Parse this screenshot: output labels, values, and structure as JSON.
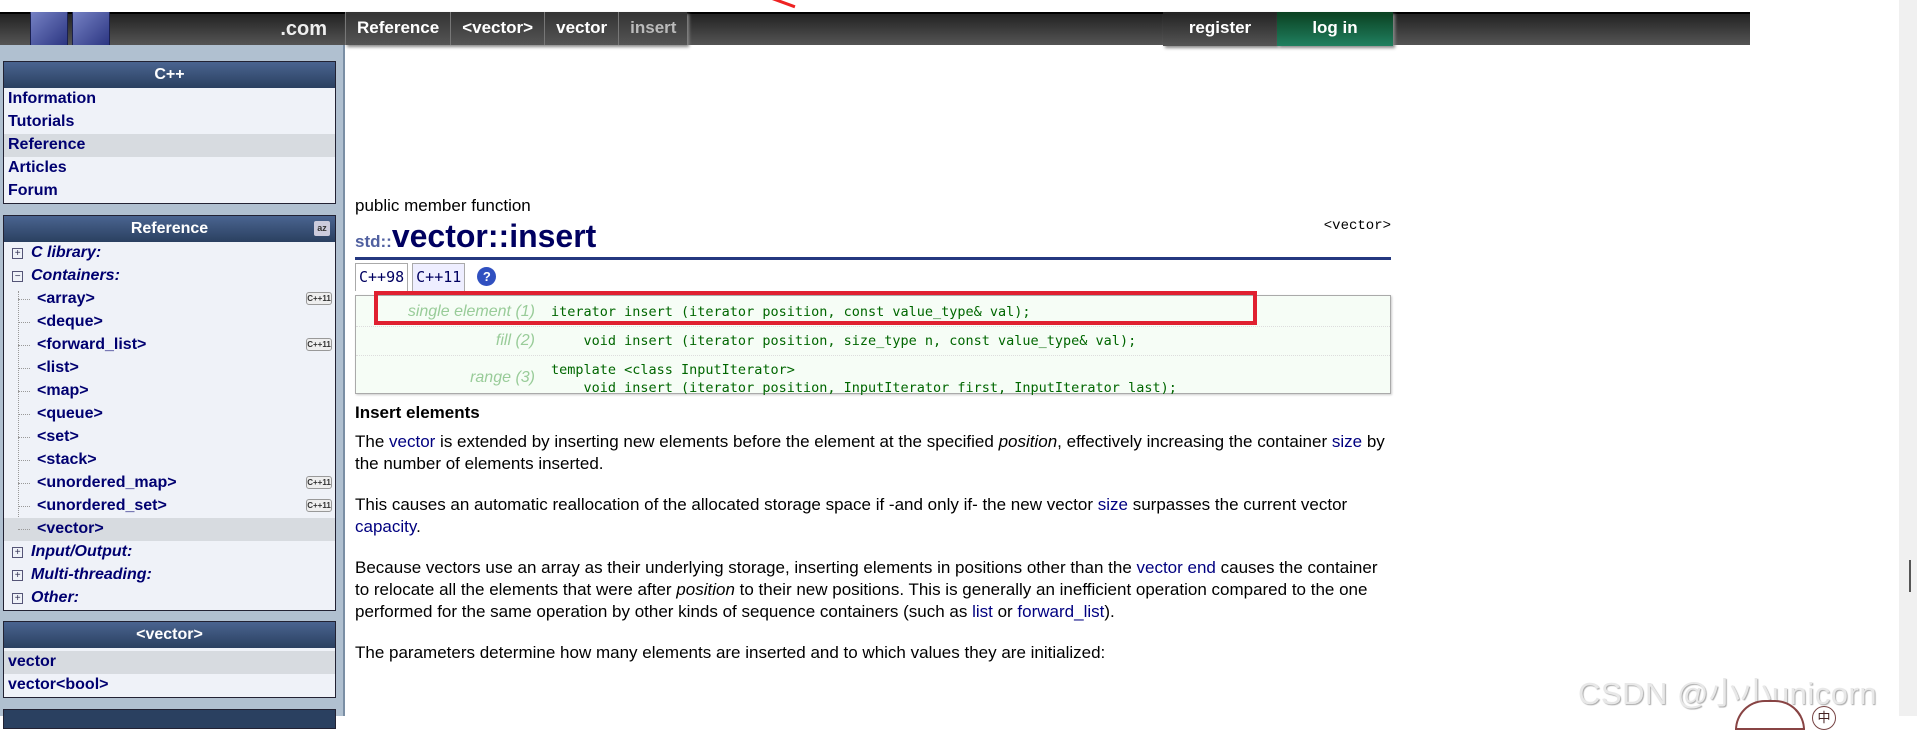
{
  "header": {
    "logo_suffix": ".com",
    "breadcrumb": [
      "Reference",
      "<vector>",
      "vector",
      "insert"
    ],
    "register_label": "register",
    "login_label": "log in"
  },
  "sidebar": {
    "cpp_box": {
      "title": "C++",
      "items": [
        "Information",
        "Tutorials",
        "Reference",
        "Articles",
        "Forum"
      ],
      "selected": "Reference"
    },
    "reference_box": {
      "title": "Reference",
      "az_icon": "a-z-sort-icon",
      "categories": {
        "c_library": "C library:",
        "containers": "Containers:",
        "input_output": "Input/Output:",
        "multi_threading": "Multi-threading:",
        "other": "Other:"
      },
      "containers": [
        "<array>",
        "<deque>",
        "<forward_list>",
        "<list>",
        "<map>",
        "<queue>",
        "<set>",
        "<stack>",
        "<unordered_map>",
        "<unordered_set>",
        "<vector>"
      ],
      "cpp11_badge": "C++11",
      "selected": "<vector>"
    },
    "vector_box": {
      "title": "<vector>",
      "items": [
        "vector",
        "vector<bool>"
      ],
      "selected": "vector"
    }
  },
  "main": {
    "kind": "public member function",
    "title_ns": "std::",
    "title": "vector::insert",
    "header_file": "<vector>",
    "tabs": [
      "C++98",
      "C++11"
    ],
    "help_icon": "?",
    "prototypes": [
      {
        "label": "single element (1)",
        "code": "iterator insert (iterator position, const value_type& val);"
      },
      {
        "label": "fill (2)",
        "code": "    void insert (iterator position, size_type n, const value_type& val);"
      },
      {
        "label": "range (3)",
        "code": "template <class InputIterator>\n    void insert (iterator position, InputIterator first, InputIterator last);"
      }
    ],
    "highlight_color": "#e02030",
    "section_heading": "Insert elements",
    "p1": {
      "a": "The ",
      "l1": "vector",
      "b": " is extended by inserting new elements before the element at the specified ",
      "i1": "position",
      "c": ", effectively increasing the container ",
      "l2": "size",
      "d": " by the number of elements inserted."
    },
    "p2": {
      "a": "This causes an automatic reallocation of the allocated storage space if -and only if- the new vector ",
      "l1": "size",
      "b": " surpasses the current vector ",
      "l2": "capacity",
      "c": "."
    },
    "p3": {
      "a": "Because vectors use an array as their underlying storage, inserting elements in positions other than the ",
      "l1": "vector end",
      "b": " causes the container to relocate all the elements that were after ",
      "i1": "position",
      "c": " to their new positions. This is generally an inefficient operation compared to the one performed for the same operation by other kinds of sequence containers (such as ",
      "l2": "list",
      "d": " or ",
      "l3": "forward_list",
      "e": ")."
    },
    "p4": "The parameters determine how many elements are inserted and to which values they are initialized:"
  },
  "watermark": "CSDN @小小unicorn",
  "ime_indicator": "中"
}
